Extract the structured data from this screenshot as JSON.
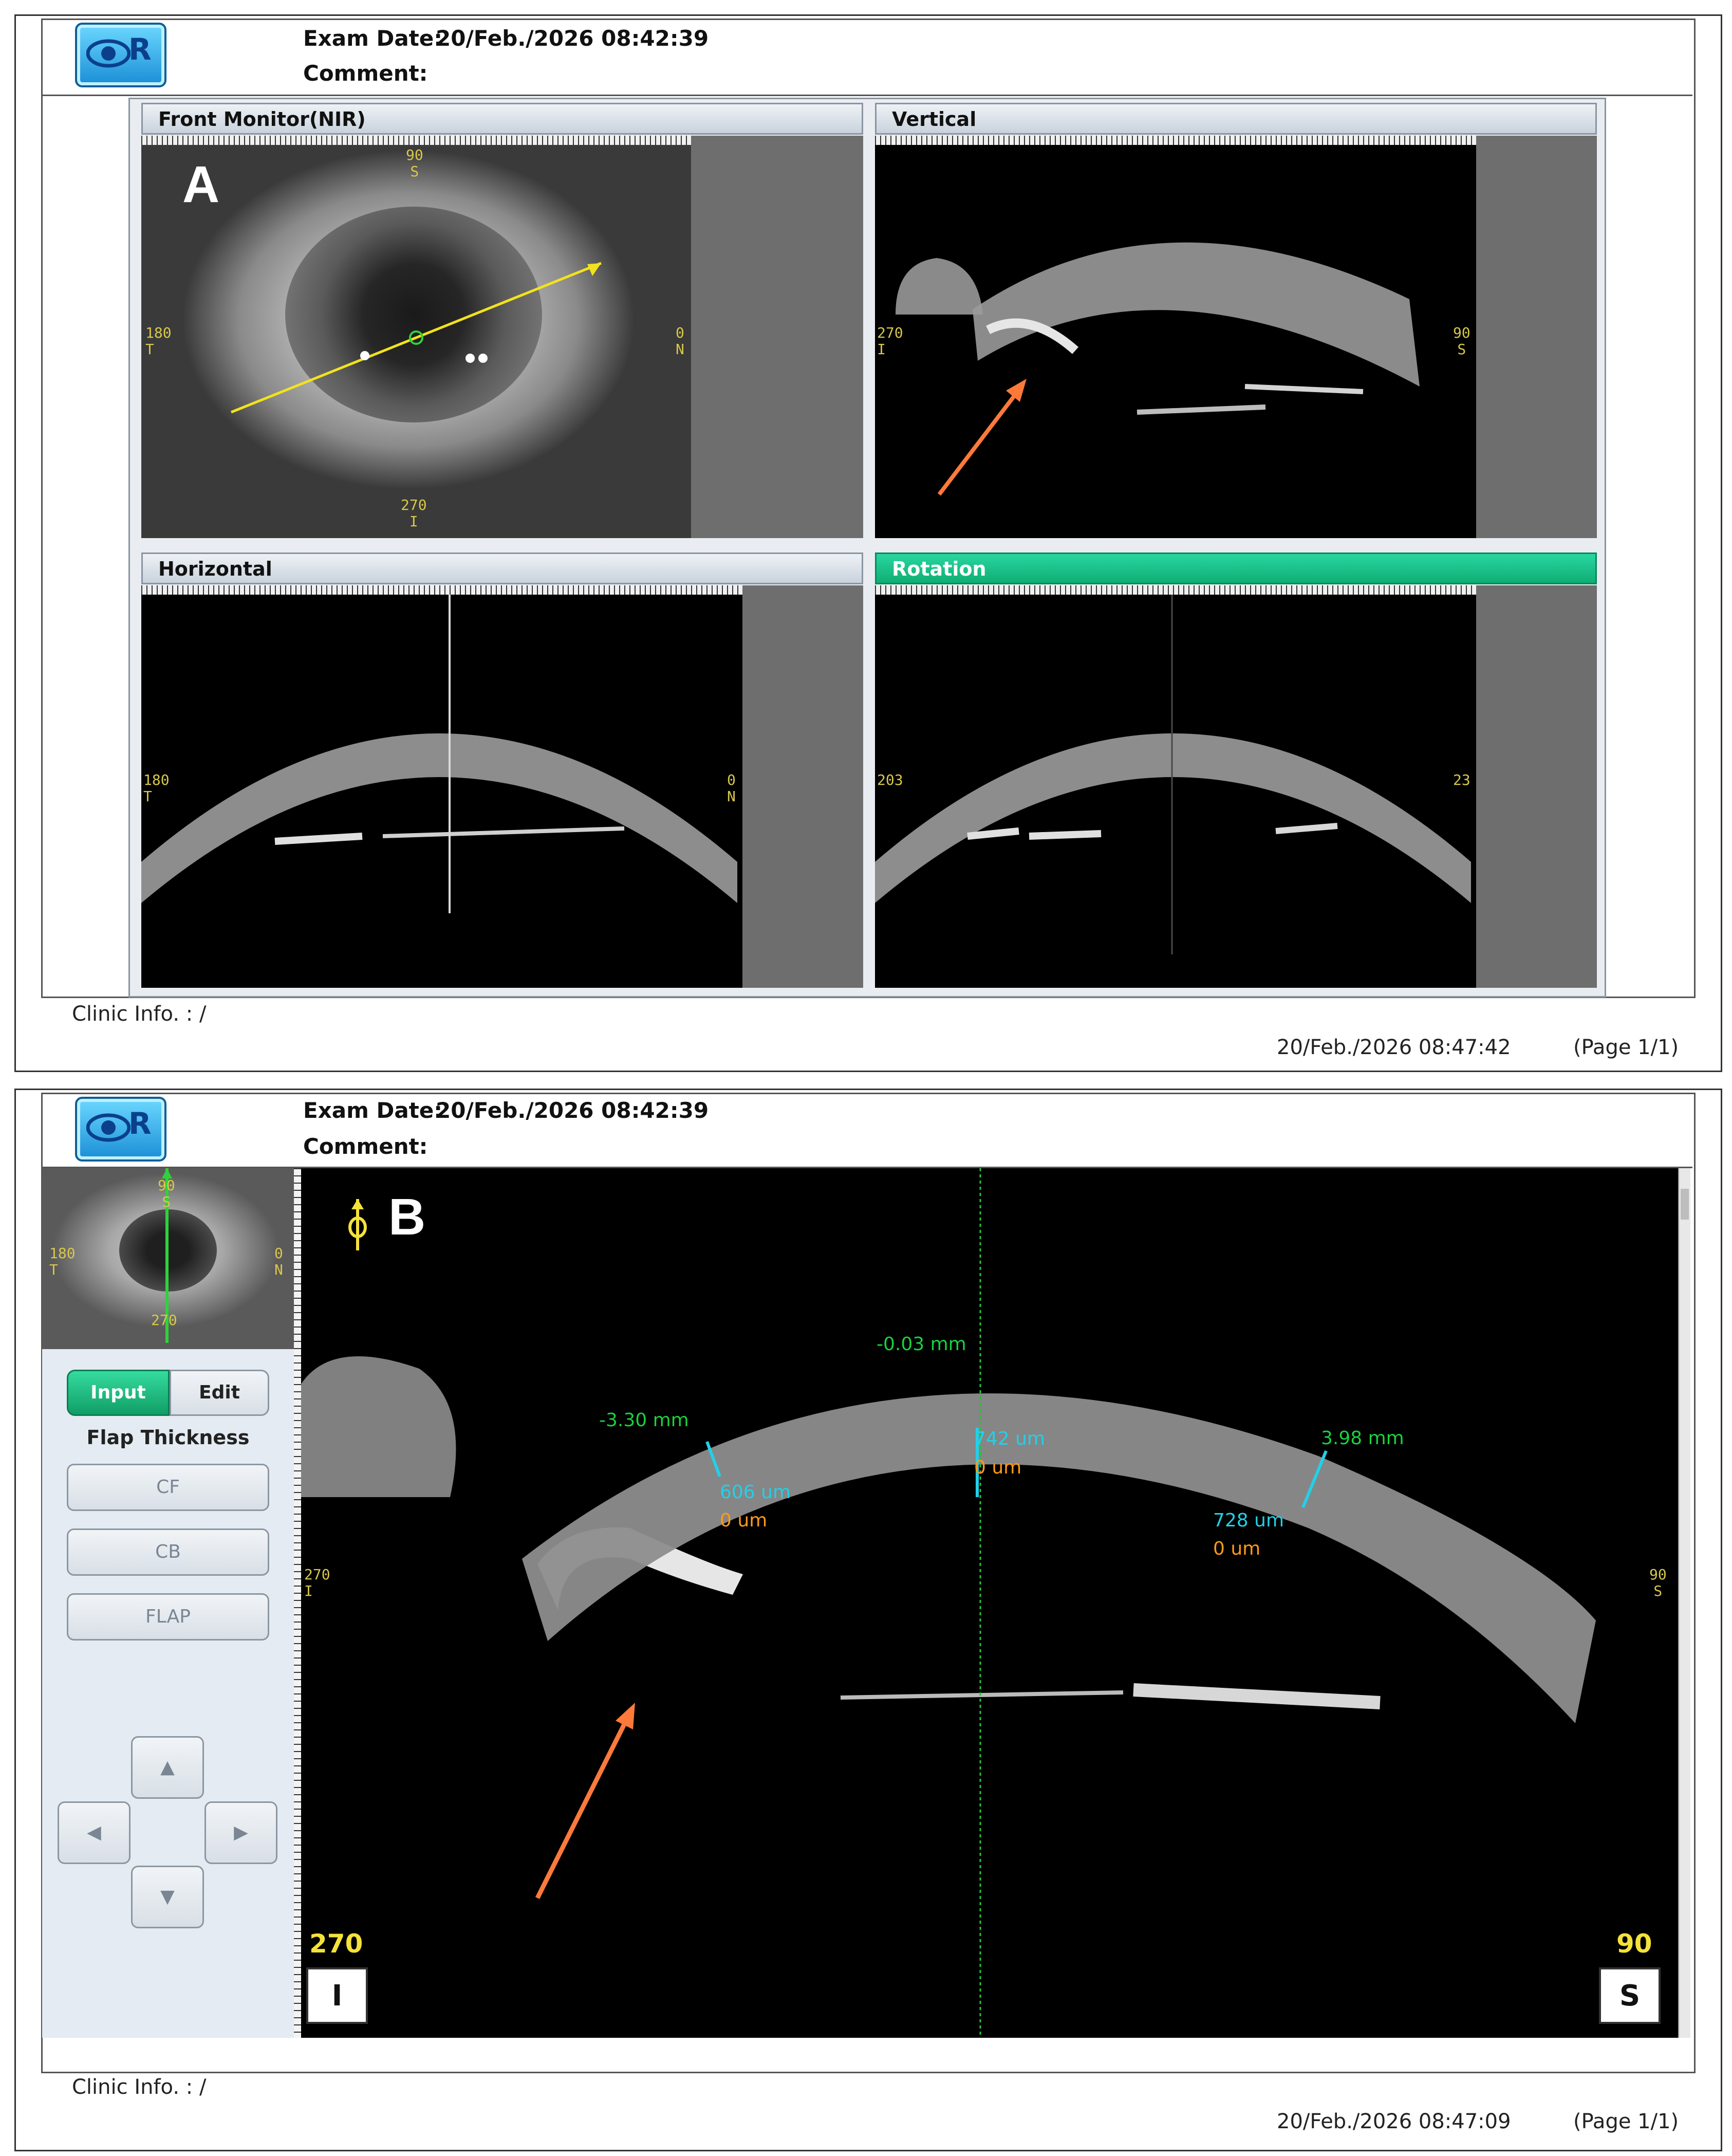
{
  "report_a": {
    "exam_date_label": "Exam Date:",
    "exam_date": "20/Feb./2026 08:42:39",
    "comment_label": "Comment:",
    "panel_letter": "A",
    "panels": {
      "front": {
        "title": "Front Monitor(NIR)",
        "top": "90",
        "top2": "S",
        "left": "180",
        "left2": "T",
        "right": "0",
        "right2": "N",
        "bottom": "270",
        "bottom2": "I"
      },
      "vertical": {
        "title": "Vertical",
        "left": "270",
        "left2": "I",
        "right": "90",
        "right2": "S"
      },
      "horizontal": {
        "title": "Horizontal",
        "left": "180",
        "left2": "T",
        "right": "0",
        "right2": "N"
      },
      "rotation": {
        "title": "Rotation",
        "left": "203",
        "right": "23"
      }
    },
    "clinic_info": "Clinic Info. :   /",
    "printed": "20/Feb./2026 08:47:42",
    "page": "(Page 1/1)"
  },
  "report_b": {
    "exam_date_label": "Exam Date:",
    "exam_date": "20/Feb./2026 08:42:39",
    "comment_label": "Comment:",
    "panel_letter": "B",
    "thumb": {
      "top": "90",
      "top2": "S",
      "left": "180",
      "left2": "T",
      "right": "0",
      "right2": "N",
      "bottom": "270"
    },
    "tabs": {
      "input": "Input",
      "edit": "Edit"
    },
    "section_title": "Flap Thickness",
    "buttons": {
      "cf": "CF",
      "cb": "CB",
      "flap": "FLAP"
    },
    "measurements": {
      "left_pos": "-3.30 mm",
      "left_thick": "606 um",
      "left_zero": "0 um",
      "center_pos": "-0.03 mm",
      "center_thick": "742 um",
      "center_zero": "0 um",
      "right_pos": "3.98 mm",
      "right_thick": "728 um",
      "right_zero": "0 um"
    },
    "side_left": "270",
    "side_left2": "I",
    "side_right": "90",
    "side_right2": "S",
    "corner_left_num": "270",
    "corner_left_box": "I",
    "corner_right_num": "90",
    "corner_right_box": "S",
    "clinic_info": "Clinic Info. :   /",
    "printed": "20/Feb./2026 08:47:09",
    "page": "(Page 1/1)"
  },
  "colors": {
    "accent": "#0fae74",
    "arrow": "#ff7a3a",
    "scan_line": "#f2e21e",
    "label": "#d8c84a"
  }
}
